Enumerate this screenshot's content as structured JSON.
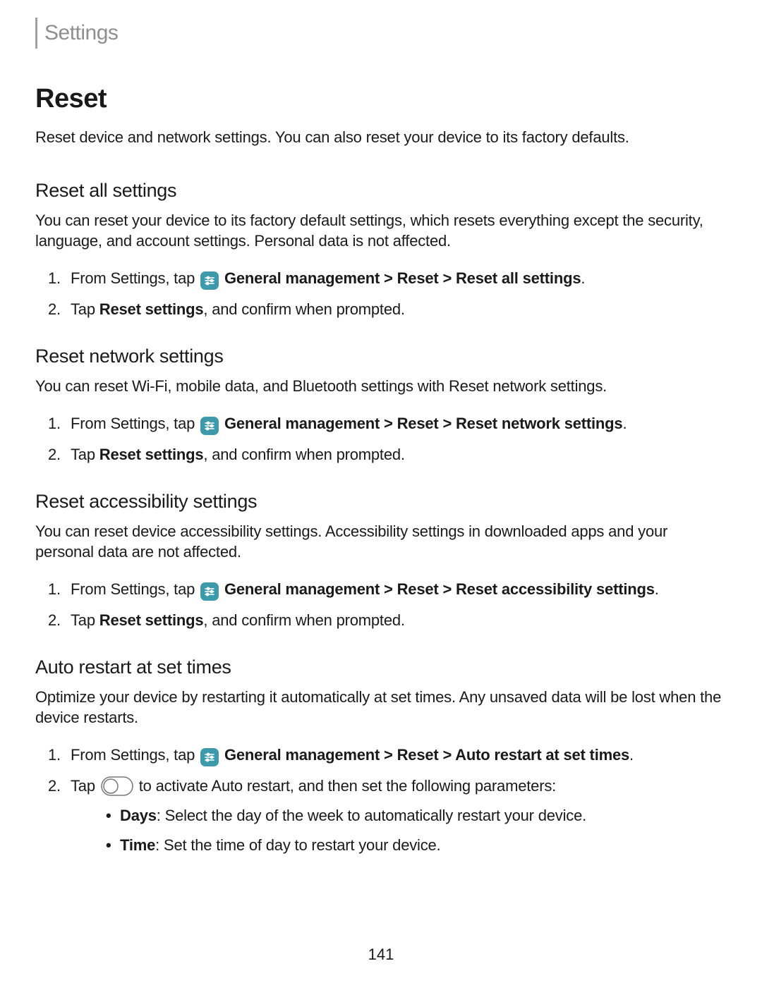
{
  "header": {
    "title": "Settings"
  },
  "page_number": "141",
  "main": {
    "heading": "Reset",
    "intro": "Reset device and network settings. You can also reset your device to its factory defaults."
  },
  "sections": {
    "reset_all": {
      "heading": "Reset all settings",
      "desc": "You can reset your device to its factory default settings, which resets everything except the security, language, and account settings. Personal data is not affected.",
      "step1_prefix": "From Settings, tap ",
      "step1_path": "General management > Reset > Reset all settings",
      "step1_period": ".",
      "step2_prefix": "Tap ",
      "step2_bold": "Reset settings",
      "step2_suffix": ", and confirm when prompted."
    },
    "reset_network": {
      "heading": "Reset network settings",
      "desc": "You can reset Wi-Fi, mobile data, and Bluetooth settings with Reset network settings.",
      "step1_prefix": "From Settings, tap ",
      "step1_path": "General management > Reset > Reset network settings",
      "step1_period": ".",
      "step2_prefix": "Tap ",
      "step2_bold": "Reset settings",
      "step2_suffix": ", and confirm when prompted."
    },
    "reset_accessibility": {
      "heading": "Reset accessibility settings",
      "desc": "You can reset device accessibility settings. Accessibility settings in downloaded apps and your personal data are not affected.",
      "step1_prefix": "From Settings, tap ",
      "step1_path": "General management > Reset > Reset accessibility settings",
      "step1_period": ".",
      "step2_prefix": "Tap ",
      "step2_bold": "Reset settings",
      "step2_suffix": ", and confirm when prompted."
    },
    "auto_restart": {
      "heading": "Auto restart at set times",
      "desc": "Optimize your device by restarting it automatically at set times. Any unsaved data will be lost when the device restarts.",
      "step1_prefix": "From Settings, tap ",
      "step1_path": "General management > Reset > Auto restart at set times",
      "step1_period": ".",
      "step2_prefix": "Tap ",
      "step2_suffix": " to activate Auto restart, and then set the following parameters:",
      "bullet1_bold": "Days",
      "bullet1_suffix": ": Select the day of the week to automatically restart your device.",
      "bullet2_bold": "Time",
      "bullet2_suffix": ": Set the time of day to restart your device."
    }
  }
}
